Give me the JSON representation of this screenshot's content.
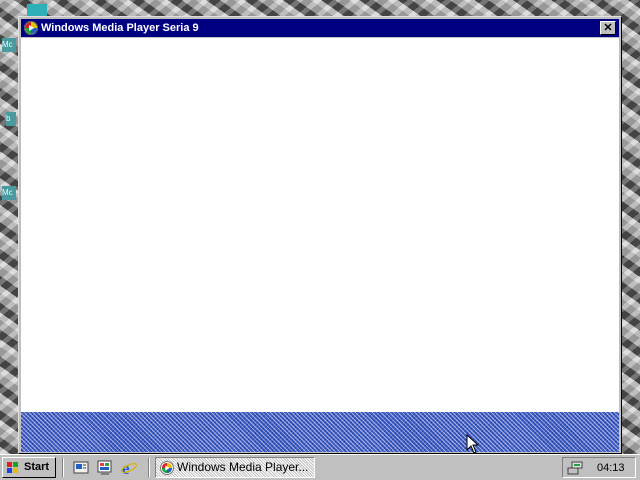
{
  "window": {
    "title": "Windows Media Player Seria 9",
    "close_glyph": "✕"
  },
  "desktop": {
    "icon_fragments": [
      "Mc",
      "b",
      "Mc"
    ]
  },
  "taskbar": {
    "start_label": "Start",
    "quick_launch": [
      "show-desktop-icon",
      "channels-icon",
      "internet-explorer-icon"
    ],
    "tasks": [
      {
        "label": "Windows Media Player...",
        "icon": "media-player-icon",
        "active": true
      }
    ],
    "tray": {
      "icons": [
        "network-icon"
      ],
      "clock": "04:13"
    }
  },
  "colors": {
    "titlebar": "#000080",
    "taskbar": "#c0c0c0",
    "status_band": "#3f5fc8"
  }
}
